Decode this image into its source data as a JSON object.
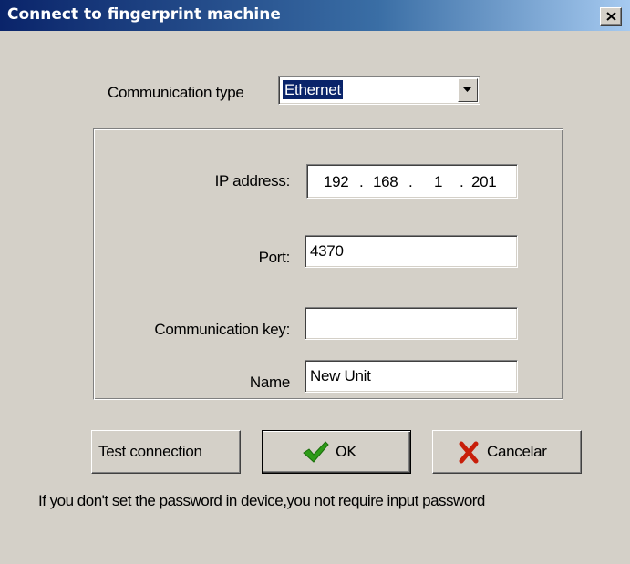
{
  "window": {
    "title": "Connect to fingerprint machine"
  },
  "form": {
    "communication_type_label": "Communication type",
    "communication_type_value": "Ethernet",
    "ip_label": "IP address:",
    "ip_octets": [
      "192",
      "168",
      "1",
      "201"
    ],
    "port_label": "Port:",
    "port_value": "4370",
    "key_label": "Communication key:",
    "key_value": "",
    "name_label": "Name",
    "name_value": "New Unit"
  },
  "buttons": {
    "test_label": "Test connection",
    "ok_label": "OK",
    "cancel_label": "Cancelar"
  },
  "footer": {
    "note": "If you don't set the password in device,you not require input password"
  },
  "colors": {
    "title_start": "#0a246a",
    "title_end": "#a6caf0",
    "window_bg": "#d4d0c8",
    "ok_check": "#2e9b18",
    "cancel_x": "#c81e0a"
  }
}
